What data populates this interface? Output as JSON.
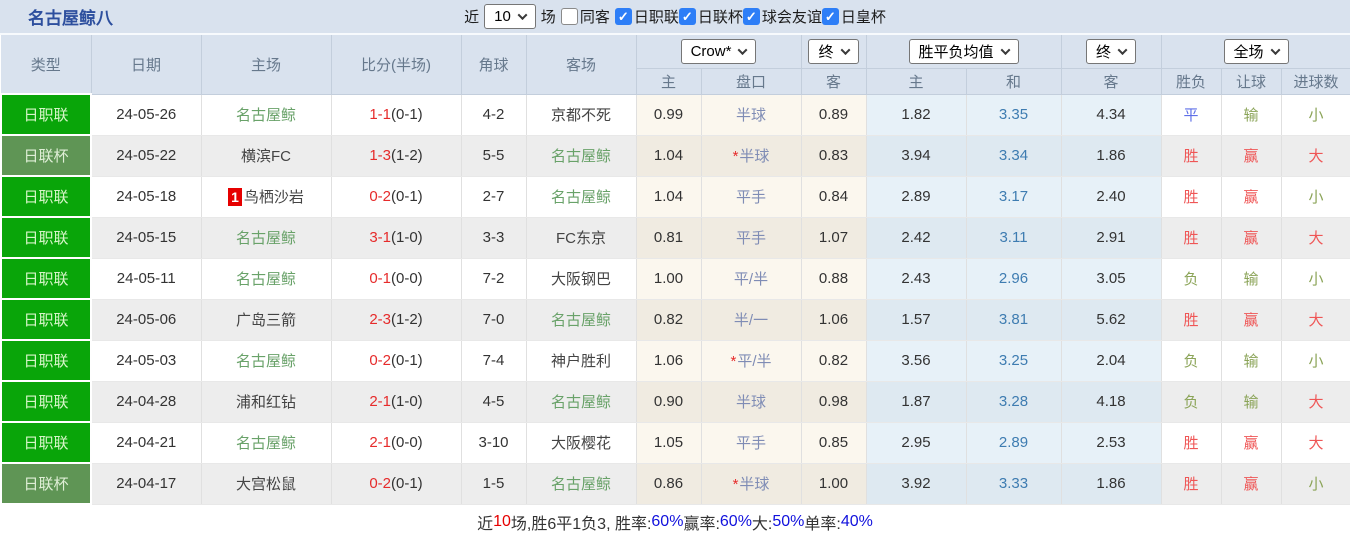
{
  "header": {
    "team_title": "名古屋鲸八"
  },
  "filters": {
    "near_label": "近",
    "near_value": "10",
    "games_label": "场",
    "same_opponent": {
      "label": "同客",
      "checked": false
    },
    "leagues": [
      {
        "label": "日职联",
        "checked": true
      },
      {
        "label": "日联杯",
        "checked": true
      },
      {
        "label": "球会友谊",
        "checked": true
      },
      {
        "label": "日皇杯",
        "checked": true
      }
    ]
  },
  "table": {
    "columns": {
      "type": "类型",
      "date": "日期",
      "home": "主场",
      "score": "比分(半场)",
      "corner": "角球",
      "away": "客场",
      "odds_sub": [
        "主",
        "盘口",
        "客"
      ],
      "avg_sub": [
        "主",
        "和",
        "客"
      ],
      "result_sub": [
        "胜负",
        "让球",
        "进球数"
      ]
    },
    "selects": {
      "odds_source": "Crow*",
      "odds_time": "终",
      "avg_source": "胜平负均值",
      "avg_time": "终",
      "result_scope": "全场"
    },
    "rows": [
      {
        "league": "日职联",
        "league_style": "j1",
        "date": "24-05-26",
        "home": "名古屋鲸",
        "home_self": true,
        "home_badge": "",
        "score": "1-1",
        "half": "(0-1)",
        "corner": "4-2",
        "away": "京都不死",
        "away_self": false,
        "odds_home": "0.99",
        "handicap": "半球",
        "handicap_star": false,
        "odds_away": "0.89",
        "avg_win": "1.82",
        "avg_draw": "3.35",
        "avg_lose": "4.34",
        "result": "平",
        "result_cls": "blue",
        "handicap_result": "输",
        "handicap_cls": "green",
        "goals": "小",
        "goals_cls": "green"
      },
      {
        "league": "日联杯",
        "league_style": "cup",
        "date": "24-05-22",
        "home": "横滨FC",
        "home_self": false,
        "home_badge": "",
        "score": "1-3",
        "half": "(1-2)",
        "corner": "5-5",
        "away": "名古屋鲸",
        "away_self": true,
        "odds_home": "1.04",
        "handicap": "半球",
        "handicap_star": true,
        "odds_away": "0.83",
        "avg_win": "3.94",
        "avg_draw": "3.34",
        "avg_lose": "1.86",
        "result": "胜",
        "result_cls": "red",
        "handicap_result": "赢",
        "handicap_cls": "red",
        "goals": "大",
        "goals_cls": "red"
      },
      {
        "league": "日职联",
        "league_style": "j1",
        "date": "24-05-18",
        "home": "鸟栖沙岩",
        "home_self": false,
        "home_badge": "1",
        "score": "0-2",
        "half": "(0-1)",
        "corner": "2-7",
        "away": "名古屋鲸",
        "away_self": true,
        "odds_home": "1.04",
        "handicap": "平手",
        "handicap_star": false,
        "odds_away": "0.84",
        "avg_win": "2.89",
        "avg_draw": "3.17",
        "avg_lose": "2.40",
        "result": "胜",
        "result_cls": "red",
        "handicap_result": "赢",
        "handicap_cls": "red",
        "goals": "小",
        "goals_cls": "green"
      },
      {
        "league": "日职联",
        "league_style": "j1",
        "date": "24-05-15",
        "home": "名古屋鲸",
        "home_self": true,
        "home_badge": "",
        "score": "3-1",
        "half": "(1-0)",
        "corner": "3-3",
        "away": "FC东京",
        "away_self": false,
        "odds_home": "0.81",
        "handicap": "平手",
        "handicap_star": false,
        "odds_away": "1.07",
        "avg_win": "2.42",
        "avg_draw": "3.11",
        "avg_lose": "2.91",
        "result": "胜",
        "result_cls": "red",
        "handicap_result": "赢",
        "handicap_cls": "red",
        "goals": "大",
        "goals_cls": "red"
      },
      {
        "league": "日职联",
        "league_style": "j1",
        "date": "24-05-11",
        "home": "名古屋鲸",
        "home_self": true,
        "home_badge": "",
        "score": "0-1",
        "half": "(0-0)",
        "corner": "7-2",
        "away": "大阪钢巴",
        "away_self": false,
        "odds_home": "1.00",
        "handicap": "平/半",
        "handicap_star": false,
        "odds_away": "0.88",
        "avg_win": "2.43",
        "avg_draw": "2.96",
        "avg_lose": "3.05",
        "result": "负",
        "result_cls": "green",
        "handicap_result": "输",
        "handicap_cls": "green",
        "goals": "小",
        "goals_cls": "green"
      },
      {
        "league": "日职联",
        "league_style": "j1",
        "date": "24-05-06",
        "home": "广岛三箭",
        "home_self": false,
        "home_badge": "",
        "score": "2-3",
        "half": "(1-2)",
        "corner": "7-0",
        "away": "名古屋鲸",
        "away_self": true,
        "odds_home": "0.82",
        "handicap": "半/一",
        "handicap_star": false,
        "odds_away": "1.06",
        "avg_win": "1.57",
        "avg_draw": "3.81",
        "avg_lose": "5.62",
        "result": "胜",
        "result_cls": "red",
        "handicap_result": "赢",
        "handicap_cls": "red",
        "goals": "大",
        "goals_cls": "red"
      },
      {
        "league": "日职联",
        "league_style": "j1",
        "date": "24-05-03",
        "home": "名古屋鲸",
        "home_self": true,
        "home_badge": "",
        "score": "0-2",
        "half": "(0-1)",
        "corner": "7-4",
        "away": "神户胜利",
        "away_self": false,
        "odds_home": "1.06",
        "handicap": "平/半",
        "handicap_star": true,
        "odds_away": "0.82",
        "avg_win": "3.56",
        "avg_draw": "3.25",
        "avg_lose": "2.04",
        "result": "负",
        "result_cls": "green",
        "handicap_result": "输",
        "handicap_cls": "green",
        "goals": "小",
        "goals_cls": "green"
      },
      {
        "league": "日职联",
        "league_style": "j1",
        "date": "24-04-28",
        "home": "浦和红钻",
        "home_self": false,
        "home_badge": "",
        "score": "2-1",
        "half": "(1-0)",
        "corner": "4-5",
        "away": "名古屋鲸",
        "away_self": true,
        "odds_home": "0.90",
        "handicap": "半球",
        "handicap_star": false,
        "odds_away": "0.98",
        "avg_win": "1.87",
        "avg_draw": "3.28",
        "avg_lose": "4.18",
        "result": "负",
        "result_cls": "green",
        "handicap_result": "输",
        "handicap_cls": "green",
        "goals": "大",
        "goals_cls": "red"
      },
      {
        "league": "日职联",
        "league_style": "j1",
        "date": "24-04-21",
        "home": "名古屋鲸",
        "home_self": true,
        "home_badge": "",
        "score": "2-1",
        "half": "(0-0)",
        "corner": "3-10",
        "away": "大阪樱花",
        "away_self": false,
        "odds_home": "1.05",
        "handicap": "平手",
        "handicap_star": false,
        "odds_away": "0.85",
        "avg_win": "2.95",
        "avg_draw": "2.89",
        "avg_lose": "2.53",
        "result": "胜",
        "result_cls": "red",
        "handicap_result": "赢",
        "handicap_cls": "red",
        "goals": "大",
        "goals_cls": "red"
      },
      {
        "league": "日联杯",
        "league_style": "cup",
        "date": "24-04-17",
        "home": "大宫松鼠",
        "home_self": false,
        "home_badge": "",
        "score": "0-2",
        "half": "(0-1)",
        "corner": "1-5",
        "away": "名古屋鲸",
        "away_self": true,
        "odds_home": "0.86",
        "handicap": "半球",
        "handicap_star": true,
        "odds_away": "1.00",
        "avg_win": "3.92",
        "avg_draw": "3.33",
        "avg_lose": "1.86",
        "result": "胜",
        "result_cls": "red",
        "handicap_result": "赢",
        "handicap_cls": "red",
        "goals": "小",
        "goals_cls": "green"
      }
    ]
  },
  "summary": {
    "segments": [
      {
        "text": "近",
        "color": "dark"
      },
      {
        "text": "10",
        "color": "red"
      },
      {
        "text": "场,胜6平1负3, 胜率:",
        "color": "dark"
      },
      {
        "text": "60%",
        "color": "blue"
      },
      {
        "text": " 赢率:",
        "color": "dark"
      },
      {
        "text": "60%",
        "color": "blue"
      },
      {
        "text": " 大:",
        "color": "dark"
      },
      {
        "text": "50%",
        "color": "blue"
      },
      {
        "text": " 单率:",
        "color": "dark"
      },
      {
        "text": "40%",
        "color": "blue"
      }
    ]
  },
  "colors": {
    "accent_green_league": "#09a509",
    "accent_green_cup": "#5f9555",
    "score_red": "#e62b2b",
    "avg_draw_blue": "#3e7cb1",
    "result_red": "#ef5656",
    "result_green": "#8ba458",
    "result_blue": "#5e6fe8",
    "header_bg": "#d9e2ee",
    "checkbox_blue": "#2d7ef7"
  }
}
